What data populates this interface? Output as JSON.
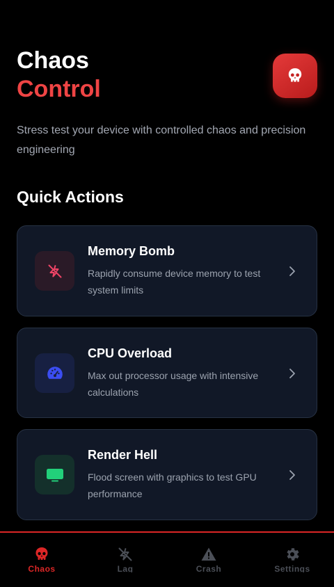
{
  "header": {
    "title_line1": "Chaos",
    "title_line2": "Control",
    "logo_icon": "skull-icon",
    "subtitle": "Stress test your device with controlled chaos and precision engineering"
  },
  "quick_actions": {
    "title": "Quick Actions",
    "items": [
      {
        "title": "Memory Bomb",
        "description": "Rapidly consume device memory to test system limits",
        "icon": "zap-off-icon",
        "icon_color": "#ef4466",
        "icon_bg": "#2a1a27"
      },
      {
        "title": "CPU Overload",
        "description": "Max out processor usage with intensive calculations",
        "icon": "gauge-icon",
        "icon_color": "#3b4df2",
        "icon_bg": "#172042"
      },
      {
        "title": "Render Hell",
        "description": "Flood screen with graphics to test GPU performance",
        "icon": "monitor-icon",
        "icon_color": "#22d07a",
        "icon_bg": "#14302b"
      }
    ]
  },
  "tabbar": {
    "tabs": [
      {
        "label": "Chaos",
        "icon": "skull-icon",
        "active": true
      },
      {
        "label": "Lag",
        "icon": "zap-off-icon",
        "active": false
      },
      {
        "label": "Crash",
        "icon": "warning-icon",
        "active": false
      },
      {
        "label": "Settings",
        "icon": "gear-icon",
        "active": false
      }
    ]
  },
  "colors": {
    "accent": "#dc2626",
    "background": "#000000",
    "card_bg": "#111827",
    "card_border": "#273244",
    "muted_text": "#9ca3af"
  }
}
